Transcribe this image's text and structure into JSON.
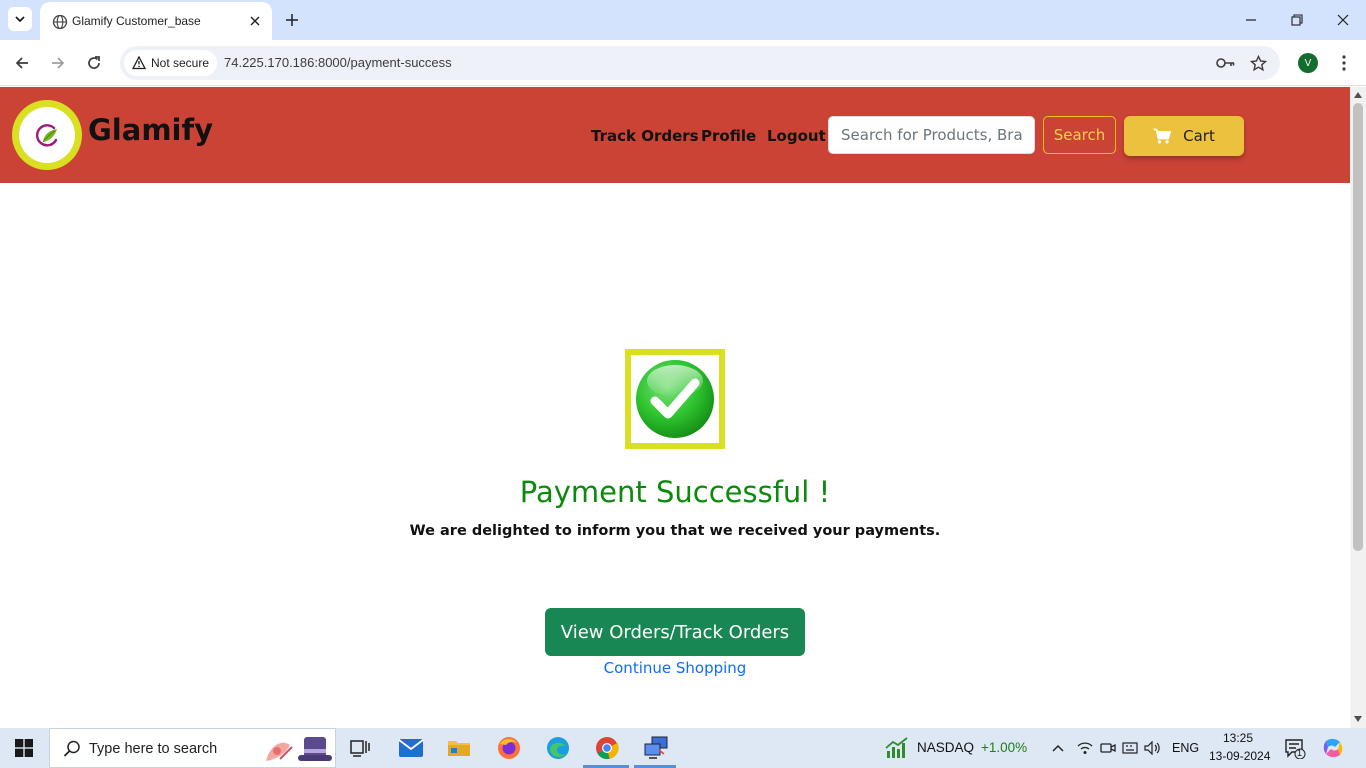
{
  "browser": {
    "tab": {
      "title": "Glamify Customer_base"
    },
    "address": {
      "security_label": "Not secure",
      "url": "74.225.170.186:8000/payment-success"
    },
    "profile_initial": "V"
  },
  "site": {
    "brand": "Glamify",
    "nav": {
      "track_orders": "Track Orders",
      "profile": "Profile",
      "logout": "Logout"
    },
    "search": {
      "placeholder": "Search for Products, Brands",
      "button": "Search"
    },
    "cart_label": "Cart",
    "colors": {
      "header": "#cb4335",
      "logo_ring": "#d9e021",
      "cart_button": "#ecc13e",
      "success_text": "#0d8a0d",
      "primary_button": "#198754",
      "link": "#0d6efd"
    }
  },
  "main": {
    "icon": "check-circle-icon",
    "title": "Payment Successful !",
    "message": "We are delighted to inform you that we received your payments.",
    "orders_button": "View Orders/Track Orders",
    "continue_link": "Continue Shopping"
  },
  "taskbar": {
    "search_placeholder": "Type here to search",
    "stock": {
      "name": "NASDAQ",
      "change": "+1.00%"
    },
    "language": "ENG",
    "time": "13:25",
    "date": "13-09-2024",
    "notification_count": "1"
  }
}
